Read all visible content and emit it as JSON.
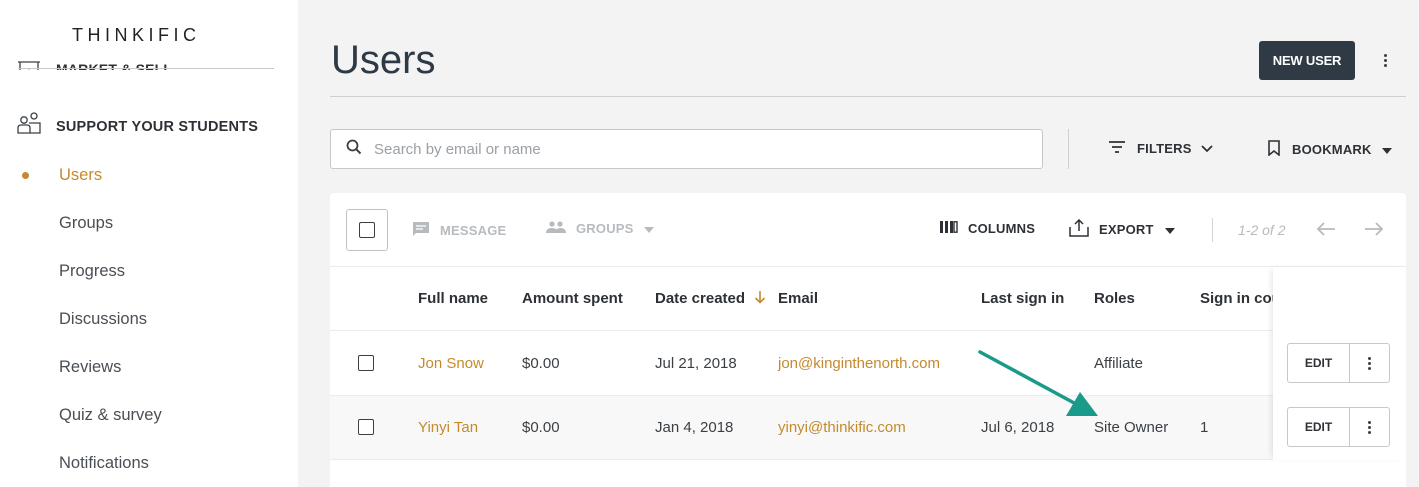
{
  "brand": {
    "logo": "THINKIFIC"
  },
  "sidebar": {
    "cut_item": "MARKET & SELL",
    "section": "SUPPORT YOUR STUDENTS",
    "items": [
      {
        "label": "Users",
        "active": true
      },
      {
        "label": "Groups"
      },
      {
        "label": "Progress"
      },
      {
        "label": "Discussions"
      },
      {
        "label": "Reviews"
      },
      {
        "label": "Quiz & survey"
      },
      {
        "label": "Notifications"
      }
    ]
  },
  "header": {
    "title": "Users",
    "new_user_label": "NEW USER"
  },
  "search": {
    "placeholder": "Search by email or name",
    "value": ""
  },
  "toolbar": {
    "filters_label": "FILTERS",
    "bookmark_label": "BOOKMARK",
    "message_label": "MESSAGE",
    "groups_label": "GROUPS",
    "columns_label": "COLUMNS",
    "export_label": "EXPORT",
    "pagination": "1-2 of 2"
  },
  "table": {
    "columns": [
      "Full name",
      "Amount spent",
      "Date created",
      "Email",
      "Last sign in",
      "Roles",
      "Sign in count"
    ],
    "rows": [
      {
        "name": "Jon Snow",
        "amount": "$0.00",
        "date_created": "Jul 21, 2018",
        "email": "jon@kinginthenorth.com",
        "last_sign_in": "",
        "role": "Affiliate",
        "sign_in_count": ""
      },
      {
        "name": "Yinyi Tan",
        "amount": "$0.00",
        "date_created": "Jan 4, 2018",
        "email": "yinyi@thinkific.com",
        "last_sign_in": "Jul 6, 2018",
        "role": "Site Owner",
        "sign_in_count": "1"
      }
    ],
    "edit_label": "EDIT"
  },
  "colors": {
    "accent": "#c48a2d",
    "dark_button": "#2f3a45",
    "annotation_arrow": "#1a9a8a"
  }
}
